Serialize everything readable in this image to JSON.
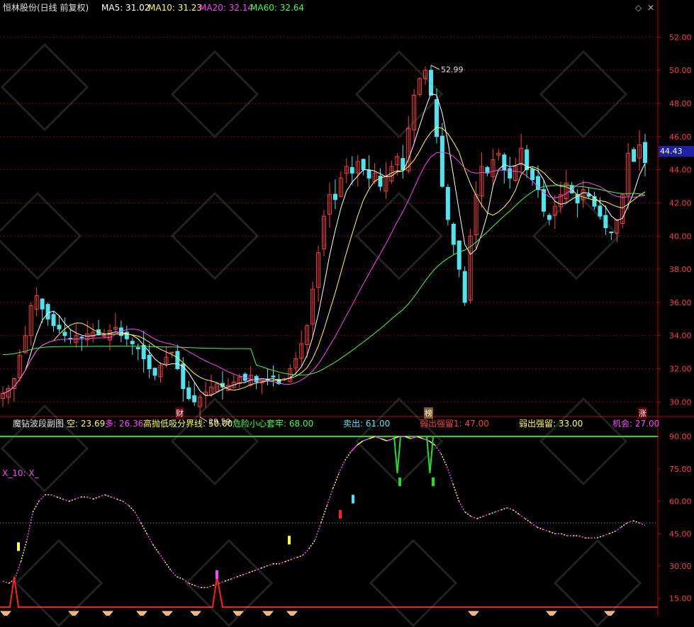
{
  "header": {
    "stock_label": "恒林股份(日线 前复权)",
    "ma5": "MA5: 31.02",
    "ma10": "MA10: 31.23",
    "ma20": "MA20: 32.14",
    "ma60": "MA60: 32.64"
  },
  "indicator_header": {
    "name": "魔钻波段副图",
    "kong": "空: 23.69",
    "duo": "多: 26.36",
    "gaopao": "高抛低吸分界线: 50.00",
    "weixian": "危险小心套牢: 68.00",
    "maichu": "卖出: 61.00",
    "ruochu1": "弱出强留1: 47.00",
    "ruochu": "弱出强留: 33.00",
    "jihui": "机会: 27.00"
  },
  "indicator_label": "X_10: X_",
  "markers": {
    "cai": "财",
    "bang": "榜",
    "zhang": "涨"
  },
  "current_price": "44.43",
  "colors": {
    "up": "#ff3c3c",
    "down": "#4de6f0",
    "ma5": "#ffffff",
    "ma10": "#ffff40",
    "ma20": "#ff40ff",
    "ma60": "#40ff40",
    "grid": "#8b0000",
    "axis": "#c00000",
    "price_box": "#1f1fa8"
  },
  "icons": [
    "diamond-icon",
    "gem-icon"
  ],
  "chart_data": [
    {
      "type": "candlestick",
      "ylim": [
        29.2,
        53.3
      ],
      "y_ticks": [
        "30.00",
        "32.00",
        "34.00",
        "36.00",
        "38.00",
        "40.00",
        "42.00",
        "44.00",
        "46.00",
        "48.00",
        "50.00",
        "52.00"
      ],
      "annotations": {
        "high": "52.99",
        "low": "29.59"
      },
      "price_path": [
        30.5,
        30.8,
        31.4,
        32.8,
        34.0,
        35.8,
        36.4,
        35.6,
        35.0,
        34.6,
        34.4,
        34.0,
        33.8,
        34.0,
        33.9,
        34.1,
        34.2,
        34.1,
        34.0,
        34.3,
        34.5,
        34.0,
        33.8,
        33.5,
        33.2,
        32.6,
        32.0,
        31.6,
        32.2,
        32.7,
        33.0,
        32.0,
        30.8,
        30.2,
        30.0,
        30.3,
        30.6,
        30.9,
        31.1,
        30.9,
        31.0,
        31.2,
        31.5,
        31.3,
        31.6,
        31.2,
        31.4,
        31.3,
        31.5,
        31.1,
        31.4,
        32.0,
        32.6,
        33.5,
        34.6,
        36.8,
        39.0,
        41.2,
        42.5,
        42.2,
        43.5,
        44.2,
        43.8,
        44.5,
        44.0,
        43.5,
        43.8,
        43.0,
        43.6,
        44.2,
        44.8,
        44.0,
        46.5,
        48.5,
        49.5,
        50.0,
        48.5,
        46.0,
        43.0,
        41.0,
        39.5,
        38.0,
        36.0,
        40.0,
        42.5,
        44.2,
        43.8,
        44.6,
        45.0,
        44.0,
        43.5,
        44.2,
        45.3,
        44.0,
        43.4,
        42.8,
        41.5,
        41.0,
        41.8,
        42.5,
        43.2,
        42.6,
        42.0,
        42.8,
        42.4,
        41.8,
        41.2,
        40.5,
        40.2,
        41.0,
        42.5,
        45.0,
        44.5,
        45.5,
        44.43
      ]
    },
    {
      "type": "line",
      "ylim": [
        8,
        93
      ],
      "y_ticks": [
        "15.00",
        "30.00",
        "45.00",
        "60.00",
        "75.00",
        "90.00"
      ],
      "series": [
        {
          "name": "多",
          "values": [
            23,
            22,
            24,
            32,
            42,
            55,
            60,
            63,
            63,
            62,
            61,
            60,
            61,
            62,
            62,
            61,
            62,
            63,
            62,
            61,
            60,
            58,
            55,
            50,
            45,
            40,
            36,
            32,
            28,
            25,
            24,
            22,
            21,
            20,
            20,
            21,
            22,
            23,
            24,
            25,
            26,
            27,
            28,
            29,
            30,
            31,
            31,
            32,
            33,
            34,
            35,
            38,
            42,
            50,
            58,
            66,
            73,
            79,
            83,
            86,
            88,
            89,
            90,
            89,
            88,
            89,
            90,
            90,
            89,
            90,
            89,
            88,
            86,
            82,
            76,
            68,
            60,
            55,
            53,
            52,
            53,
            54,
            55,
            56,
            57,
            56,
            54,
            52,
            50,
            48,
            47,
            46,
            45,
            45,
            44,
            44,
            44,
            43,
            43,
            43,
            44,
            45,
            46,
            48,
            50,
            51,
            50,
            49
          ]
        }
      ],
      "thresholds": [
        50,
        90,
        11
      ]
    }
  ]
}
